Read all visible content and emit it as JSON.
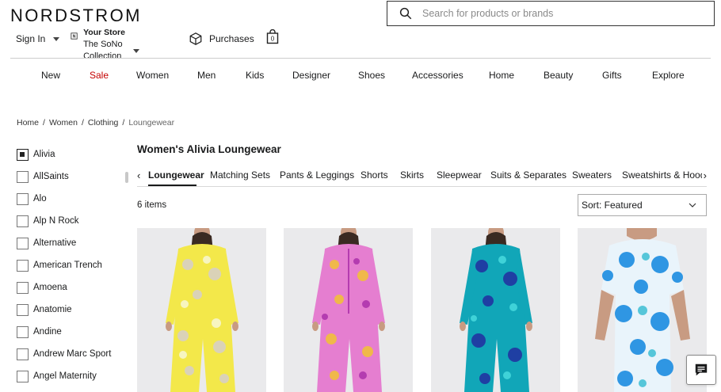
{
  "header": {
    "logo": "NORDSTROM",
    "search_placeholder": "Search for products or brands",
    "sign_in": "Sign In",
    "store_label": "Your Store",
    "store_name": "The SoNo Collection",
    "purchases": "Purchases",
    "bag_count": "0"
  },
  "nav": [
    "New",
    "Sale",
    "Women",
    "Men",
    "Kids",
    "Designer",
    "Shoes",
    "Accessories",
    "Home",
    "Beauty",
    "Gifts",
    "Explore"
  ],
  "breadcrumb": [
    "Home",
    "/",
    "Women",
    "/",
    "Clothing",
    "/",
    "Loungewear"
  ],
  "filters": [
    {
      "label": "Alivia",
      "checked": true
    },
    {
      "label": "AllSaints",
      "checked": false
    },
    {
      "label": "Alo",
      "checked": false
    },
    {
      "label": "Alp N Rock",
      "checked": false
    },
    {
      "label": "Alternative",
      "checked": false
    },
    {
      "label": "American Trench",
      "checked": false
    },
    {
      "label": "Amoena",
      "checked": false
    },
    {
      "label": "Anatomie",
      "checked": false
    },
    {
      "label": "Andine",
      "checked": false
    },
    {
      "label": "Andrew Marc Sport",
      "checked": false
    },
    {
      "label": "Angel Maternity",
      "checked": false
    }
  ],
  "page_title": "Women's Alivia Loungewear",
  "tabs": [
    "Loungewear",
    "Matching Sets",
    "Pants & Leggings",
    "Shorts",
    "Skirts",
    "Sleepwear",
    "Suits & Separates",
    "Sweaters",
    "Sweatshirts & Hoodies"
  ],
  "item_count": "6 items",
  "sort_label": "Sort: Featured",
  "products": [
    {
      "image": "model in yellow floral pajama set",
      "primary": "#f3e84a",
      "secondary": "#d8d0c4",
      "accent": "#f7f5c0"
    },
    {
      "image": "model in pink floral pajama set",
      "primary": "#e57ed0",
      "secondary": "#f0b84a",
      "accent": "#b43cb0"
    },
    {
      "image": "model in teal and blue floral pajama set",
      "primary": "#11a6b8",
      "secondary": "#1f3fa3",
      "accent": "#3fd2d8"
    },
    {
      "image": "model in blue and white floral short sleeve top",
      "primary": "#2f96e3",
      "secondary": "#e9f4fb",
      "accent": "#56c6d9"
    }
  ],
  "colors": {
    "sale": "#c40000",
    "text": "#191a1b"
  }
}
